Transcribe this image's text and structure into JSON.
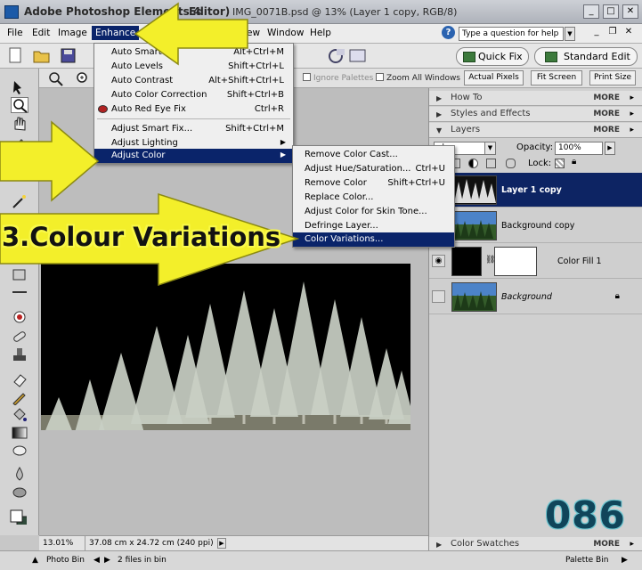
{
  "window": {
    "title_part1": "Adobe Photoshop Elements 4",
    "title_part2": "Editor)",
    "document": "IMG_0071B.psd @ 13% (Layer 1 copy, RGB/8)"
  },
  "menubar": {
    "items": [
      "File",
      "Edit",
      "Image",
      "Enhance",
      "ew",
      "Window",
      "Help"
    ],
    "active": "Enhance",
    "help_placeholder": "Type a question for help"
  },
  "toolbar": {
    "quick_fix": "Quick Fix",
    "standard_edit": "Standard Edit"
  },
  "options_bar": {
    "ignore_palettes": "Ignore Palettes",
    "zoom_all_windows": "Zoom All Windows",
    "actual_pixels": "Actual Pixels",
    "fit_screen": "Fit Screen",
    "print_size": "Print Size"
  },
  "enhance_menu": {
    "items": [
      {
        "label": "Auto Smart",
        "shortcut": "Alt+Ctrl+M"
      },
      {
        "label": "Auto Levels",
        "shortcut": "Shift+Ctrl+L"
      },
      {
        "label": "Auto Contrast",
        "shortcut": "Alt+Shift+Ctrl+L"
      },
      {
        "label": "Auto Color Correction",
        "shortcut": "Shift+Ctrl+B"
      },
      {
        "label": "Auto Red Eye Fix",
        "shortcut": "Ctrl+R"
      },
      {
        "label": "Adjust Smart Fix...",
        "shortcut": "Shift+Ctrl+M"
      },
      {
        "label": "Adjust Lighting",
        "shortcut": ""
      },
      {
        "label": "Adjust Color",
        "shortcut": ""
      }
    ]
  },
  "adjust_color_menu": {
    "items": [
      {
        "label": "Remove Color Cast...",
        "shortcut": ""
      },
      {
        "label": "Adjust Hue/Saturation...",
        "shortcut": "Ctrl+U"
      },
      {
        "label": "Remove Color",
        "shortcut": "Shift+Ctrl+U"
      },
      {
        "label": "Replace Color...",
        "shortcut": ""
      },
      {
        "label": "Adjust Color for Skin Tone...",
        "shortcut": ""
      },
      {
        "label": "Defringe Layer...",
        "shortcut": ""
      },
      {
        "label": "Color Variations...",
        "shortcut": ""
      }
    ]
  },
  "annotation": {
    "caption": "3.Colour Variations",
    "number": "086",
    "arrow_color": "#f3ef2a"
  },
  "palette_bin": {
    "how_to": "How To",
    "styles_effects": "Styles and Effects",
    "layers": "Layers",
    "color_swatches": "Color Swatches",
    "more": "MORE",
    "blend_mode": "al",
    "opacity_label": "Opacity:",
    "opacity_value": "100%",
    "lock_label": "Lock:",
    "layer_list": [
      {
        "name": "Layer 1 copy",
        "selected": true
      },
      {
        "name": "Background copy",
        "selected": false
      },
      {
        "name": "Color Fill 1",
        "selected": false
      },
      {
        "name": "Background",
        "selected": false
      }
    ]
  },
  "status": {
    "zoom": "13.01%",
    "dimensions": "37.08 cm x 24.72 cm (240 ppi)"
  },
  "bin_bar": {
    "photo_bin": "Photo Bin",
    "files_in_bin": "2 files in bin",
    "palette_bin": "Palette Bin"
  }
}
